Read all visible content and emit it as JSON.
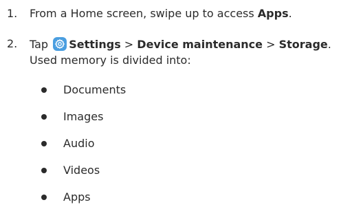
{
  "steps": [
    {
      "number": "1.",
      "pre": "From a Home screen, swipe up to access ",
      "bold": "Apps",
      "post": "."
    },
    {
      "number": "2.",
      "tap": "Tap",
      "icon": "settings-gear-icon",
      "path": [
        "Settings",
        "Device maintenance",
        "Storage"
      ],
      "sep1": " > ",
      "sep2": " > ",
      "end": ".",
      "line2": "Used memory is divided into:"
    }
  ],
  "categories": [
    "Documents",
    "Images",
    "Audio",
    "Videos",
    "Apps"
  ],
  "colors": {
    "text": "#2b2b2b",
    "icon_bg": "#4a9ee0"
  }
}
